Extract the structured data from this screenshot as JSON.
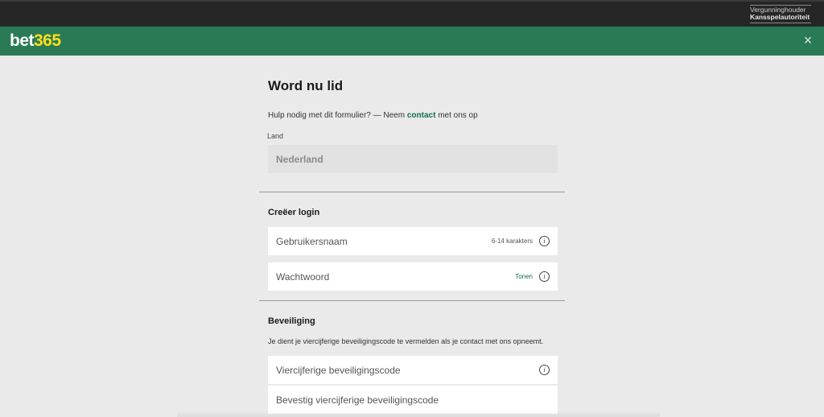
{
  "license": {
    "line1": "Vergunninghouder",
    "line2": "Kansspelautoriteit"
  },
  "header": {
    "logo_part1": "bet",
    "logo_part2": "365",
    "close_icon": "×"
  },
  "form": {
    "title": "Word nu lid",
    "help_prefix": "Hulp nodig met dit formulier? — Neem",
    "help_link": "contact",
    "help_suffix": "met ons op",
    "country_label": "Land",
    "country_value": "Nederland",
    "login_section_title": "Creëer login",
    "username_placeholder": "Gebruikersnaam",
    "username_hint": "6-14 karakters",
    "password_placeholder": "Wachtwoord",
    "password_toggle": "Tonen",
    "security_section_title": "Beveiliging",
    "security_description": "Je dient je viercijferige beveiligingscode te vermelden als je contact met ons opneemt.",
    "security_code_placeholder": "Viercijferige beveiligingscode",
    "confirm_code_placeholder": "Bevestig viercijferige beveiligingscode",
    "info_icon": "i"
  }
}
